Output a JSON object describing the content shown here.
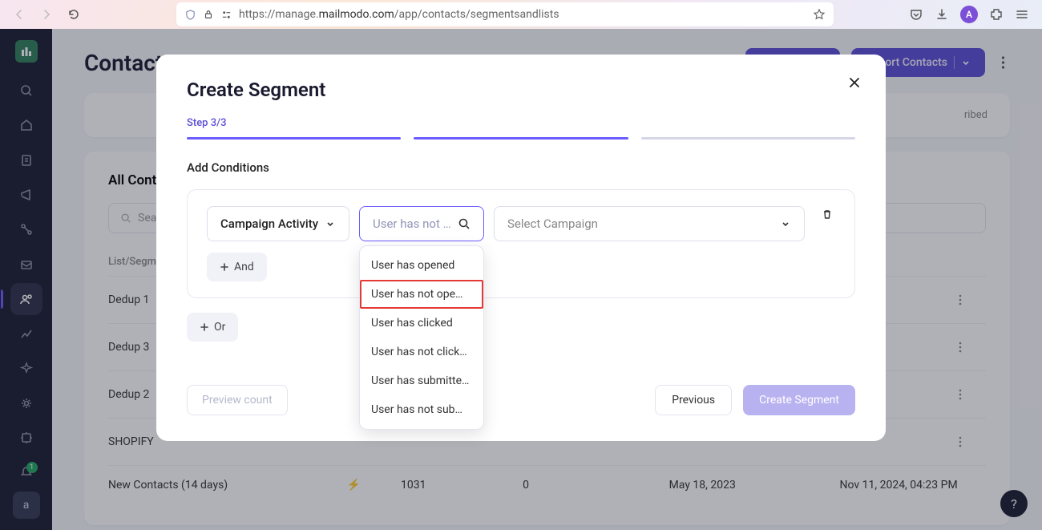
{
  "browser": {
    "url_prefix": "https://manage.",
    "url_domain": "mailmodo.com",
    "url_path": "/app/contacts/segmentsandlists",
    "avatar": "A"
  },
  "sidebar": {
    "user_initial": "a",
    "notif_count": "1"
  },
  "page": {
    "title": "Contacts",
    "import_label": "Import Contacts",
    "stats": {
      "unsubscribed": "ribed"
    },
    "list_title": "All Contacts",
    "search_placeholder": "Sea",
    "columns": {
      "name": "List/Segment",
      "count": "",
      "created": "",
      "modified": ""
    },
    "rows": [
      {
        "name": "Dedup 1",
        "count": "",
        "created": "",
        "modified": ""
      },
      {
        "name": "Dedup 3",
        "count": "",
        "created": "",
        "modified": ""
      },
      {
        "name": "Dedup 2",
        "count": "",
        "created": "",
        "modified": ""
      },
      {
        "name": "SHOPIFY",
        "count": "",
        "created": "",
        "modified": ""
      },
      {
        "name": "New Contacts (14 days)",
        "count": "1031",
        "created": "0",
        "modified": "May 18, 2023",
        "extra": "Nov 11, 2024, 04:23 PM"
      }
    ]
  },
  "modal": {
    "title": "Create Segment",
    "step": "Step 3/3",
    "section": "Add Conditions",
    "activity_value": "Campaign Activity",
    "behavior_placeholder": "User has not o…",
    "campaign_placeholder": "Select Campaign",
    "dropdown": [
      "User has opened",
      "User has not ope…",
      "User has clicked",
      "User has not click…",
      "User has submitte…",
      "User has not sub…"
    ],
    "and_label": "And",
    "or_label": "Or",
    "preview_label": "Preview count",
    "previous_label": "Previous",
    "create_label": "Create Segment"
  },
  "help": "?"
}
